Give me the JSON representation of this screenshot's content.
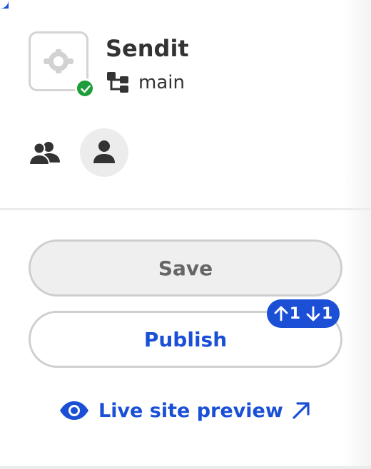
{
  "project": {
    "name": "Sendit",
    "branch": "main",
    "logo_icon": "project-logo-icon",
    "status": "deployed-ok"
  },
  "people": {
    "group_icon": "users-group-icon",
    "avatar_icon": "user-avatar-icon"
  },
  "actions": {
    "save_label": "Save",
    "publish_label": "Publish",
    "sync_badge": {
      "ahead": "1",
      "behind": "1"
    },
    "preview_label": "Live site preview"
  },
  "colors": {
    "accent": "#1a4fd6",
    "success": "#1e9e3a",
    "text": "#333333",
    "muted": "#666666"
  }
}
